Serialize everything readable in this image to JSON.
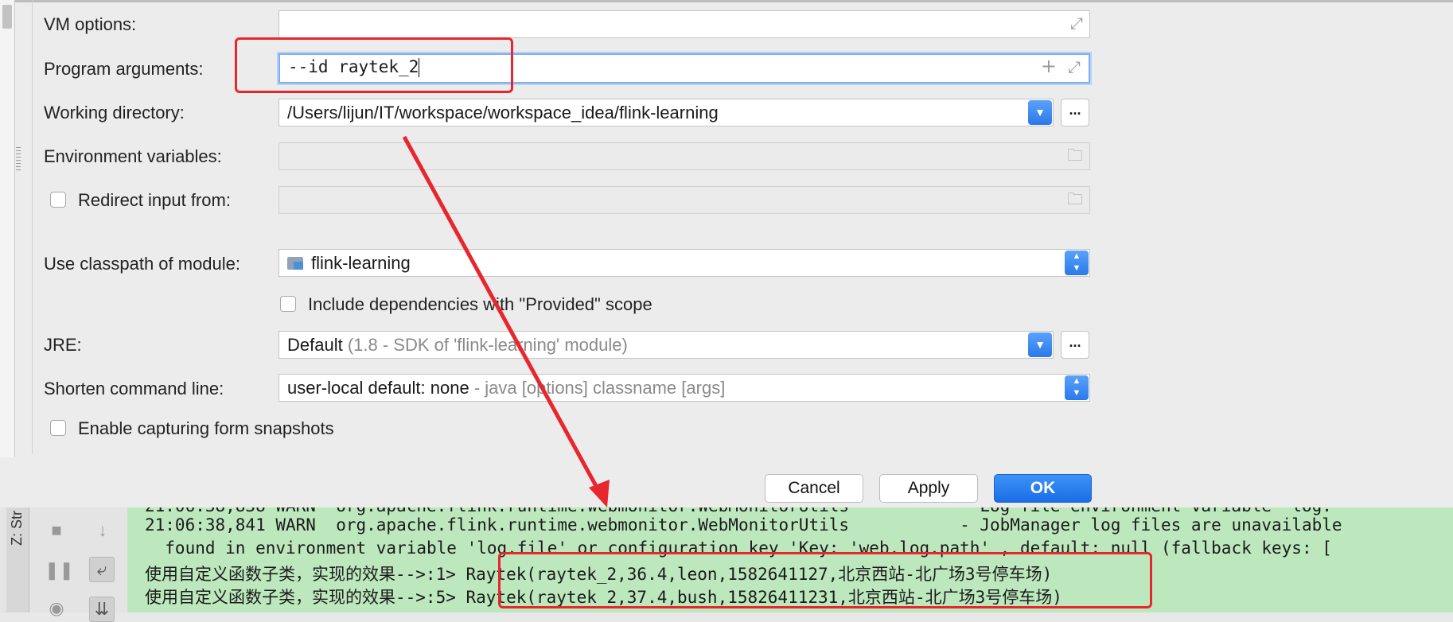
{
  "form": {
    "vm_options": {
      "label": "VM options:",
      "value": ""
    },
    "program_arguments": {
      "label": "Program arguments:",
      "value": "--id raytek_2"
    },
    "working_directory": {
      "label": "Working directory:",
      "value": "/Users/lijun/IT/workspace/workspace_idea/flink-learning"
    },
    "environment_variables": {
      "label": "Environment variables:",
      "value": ""
    },
    "redirect_input": {
      "label": "Redirect input from:",
      "checked": false,
      "value": ""
    },
    "classpath_module": {
      "label": "Use classpath of module:",
      "value": "flink-learning"
    },
    "include_provided": {
      "label": "Include dependencies with \"Provided\" scope",
      "checked": false
    },
    "jre": {
      "label": "JRE:",
      "value": "Default",
      "detail": "(1.8 - SDK of 'flink-learning' module)"
    },
    "shorten_command_line": {
      "label": "Shorten command line:",
      "value": "user-local default: none",
      "detail": "- java [options] classname [args]"
    },
    "capture_snapshots": {
      "label": "Enable capturing form snapshots",
      "checked": false
    }
  },
  "buttons": {
    "cancel": "Cancel",
    "apply": "Apply",
    "ok": "OK",
    "browse": "..."
  },
  "console": {
    "tab_label": "Z: Str",
    "lines": [
      "21:06:38,841 WARN  org.apache.flink.runtime.webmonitor.WebMonitorUtils           - JobManager log files are unavailable",
      "  found in environment variable 'log.file' or configuration key 'Key: 'web.log.path' , default: null (fallback keys: [",
      "使用自定义函数子类，实现的效果-->:1> Raytek(raytek_2,36.4,leon,1582641127,北京西站-北广场3号停车场)",
      "使用自定义函数子类，实现的效果-->:5> Raytek(raytek_2,37.4,bush,15826411231,北京西站-北广场3号停车场)"
    ]
  },
  "colors": {
    "accent": "#2b79ea",
    "highlight": "#e8262d",
    "console_bg": "#bde8bd"
  }
}
